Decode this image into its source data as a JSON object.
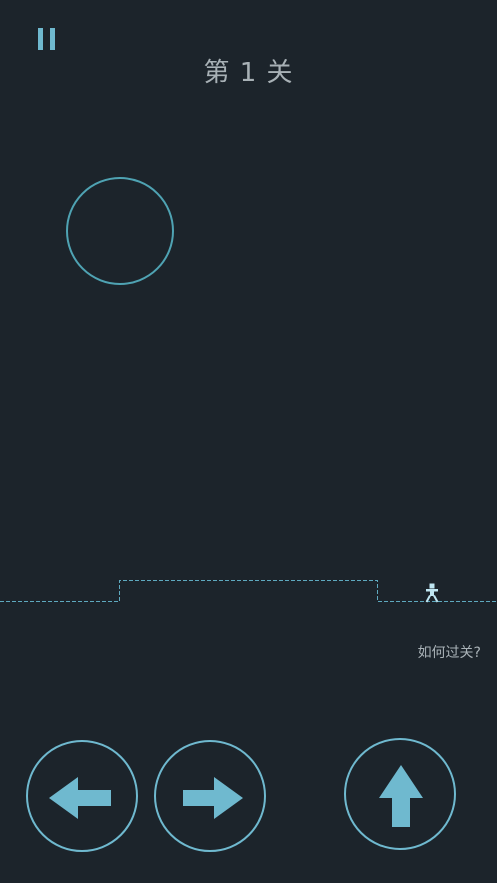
{
  "hud": {
    "level_title": "第 1 关",
    "pause_icon": "pause-icon"
  },
  "world": {
    "target_icon": "ring-icon",
    "player_icon": "stick-figure-icon"
  },
  "help": {
    "label": "如何过关?"
  },
  "controls": {
    "left_icon": "arrow-left-icon",
    "right_icon": "arrow-right-icon",
    "jump_icon": "arrow-up-icon"
  },
  "colors": {
    "background": "#1c242b",
    "accent": "#6fb9cf",
    "ring": "#4fa3b3",
    "text": "#a8b1b6"
  }
}
